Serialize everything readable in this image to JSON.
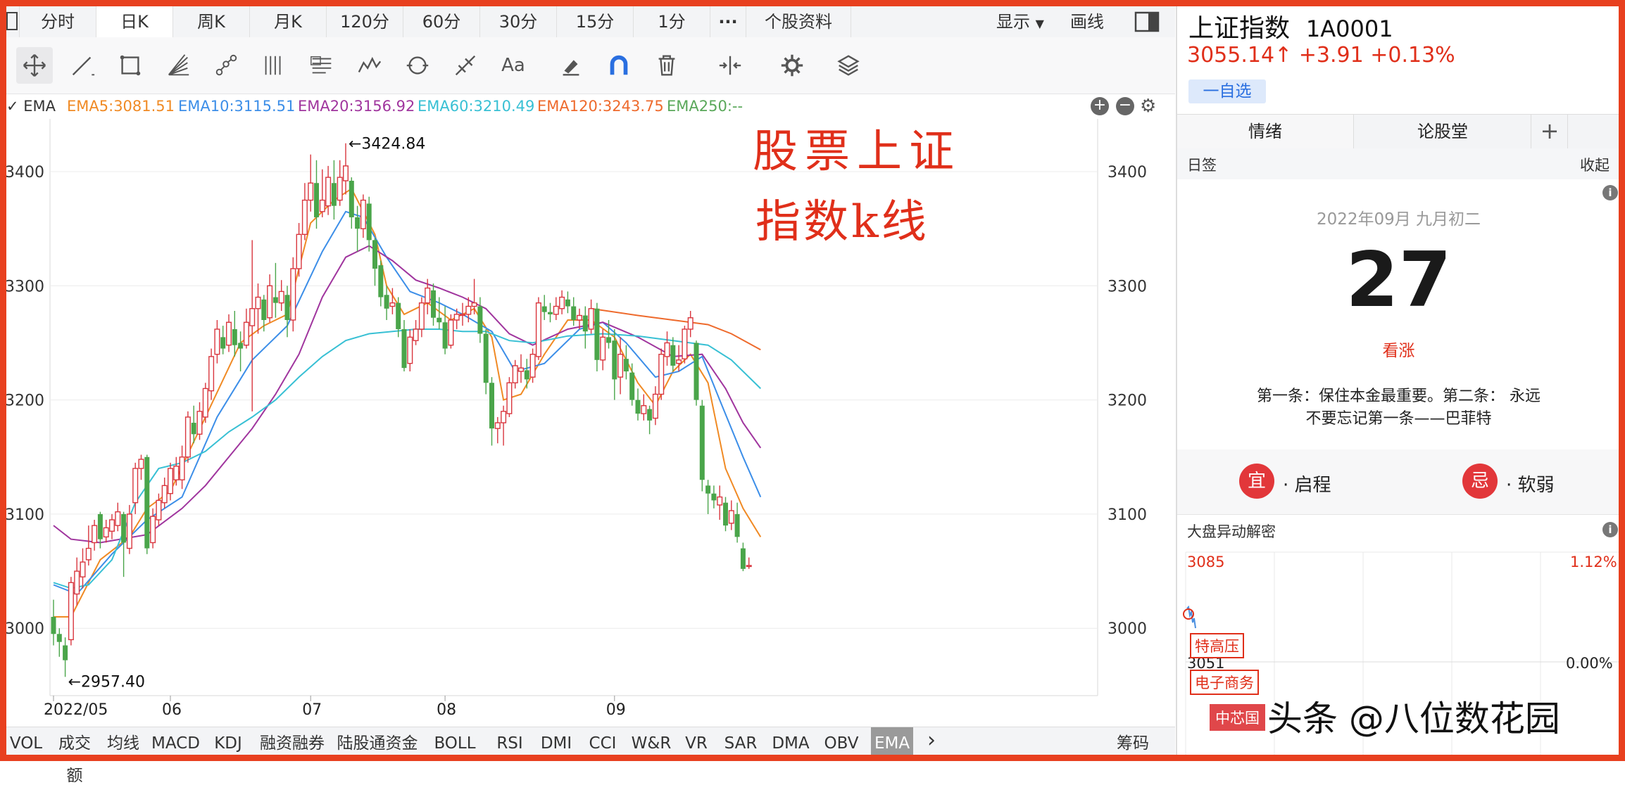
{
  "period_tabs": [
    "分时",
    "日K",
    "周K",
    "月K",
    "120分",
    "60分",
    "30分",
    "15分",
    "1分",
    "···",
    "个股资料",
    "显示",
    "画线"
  ],
  "active_period": 1,
  "ema_legend": {
    "label": "EMA",
    "items": [
      {
        "text": "EMA5:3081.51",
        "color": "#f08a24"
      },
      {
        "text": "EMA10:3115.51",
        "color": "#3c8ee8"
      },
      {
        "text": "EMA20:3156.92",
        "color": "#a0359e"
      },
      {
        "text": "EMA60:3210.49",
        "color": "#38c0d4"
      },
      {
        "text": "EMA120:3243.75",
        "color": "#ee6a2c"
      },
      {
        "text": "EMA250:--",
        "color": "#5aa85a"
      }
    ]
  },
  "annotation": {
    "line1": "股票上证",
    "line2": "指数k线",
    "color": "#e02f1a"
  },
  "indicator_tabs": [
    "VOL",
    "成交额",
    "均线",
    "MACD",
    "KDJ",
    "融资融券",
    "陆股通资金",
    "BOLL",
    "RSI",
    "DMI",
    "CCI",
    "W&R",
    "VR",
    "SAR",
    "DMA",
    "OBV",
    "EMA"
  ],
  "active_indicator": 16,
  "indicator_more": "›",
  "chips_label": "筹码",
  "chart_data": {
    "type": "candlestick",
    "x_ticks": [
      "2022/05",
      "06",
      "07",
      "08",
      "09"
    ],
    "y_ticks": [
      3000,
      3100,
      3200,
      3300,
      3400
    ],
    "ylim": [
      2940,
      3435
    ],
    "high_annotation": "←3424.84",
    "low_annotation": "←2957.40",
    "high_value": 3424.84,
    "low_value": 2957.4,
    "up_color": "#d9363e",
    "down_color": "#4aa54a",
    "candles": [
      [
        3010,
        2995,
        3025,
        2985
      ],
      [
        2995,
        2988,
        3000,
        2975
      ],
      [
        2985,
        2972,
        2992,
        2957.4
      ],
      [
        2990,
        3040,
        3045,
        2985
      ],
      [
        3030,
        3050,
        3062,
        3020
      ],
      [
        3045,
        3058,
        3070,
        3035
      ],
      [
        3060,
        3070,
        3090,
        3055
      ],
      [
        3075,
        3090,
        3095,
        3068
      ],
      [
        3100,
        3078,
        3102,
        3070
      ],
      [
        3080,
        3088,
        3095,
        3075
      ],
      [
        3085,
        3095,
        3100,
        3078
      ],
      [
        3090,
        3102,
        3110,
        3085
      ],
      [
        3100,
        3075,
        3102,
        3045
      ],
      [
        3070,
        3100,
        3108,
        3065
      ],
      [
        3110,
        3140,
        3145,
        3100
      ],
      [
        3140,
        3148,
        3152,
        3130
      ],
      [
        3150,
        3070,
        3152,
        3065
      ],
      [
        3075,
        3098,
        3105,
        3070
      ],
      [
        3095,
        3112,
        3118,
        3090
      ],
      [
        3110,
        3125,
        3132,
        3105
      ],
      [
        3118,
        3140,
        3145,
        3112
      ],
      [
        3130,
        3142,
        3150,
        3125
      ],
      [
        3130,
        3150,
        3160,
        3122
      ],
      [
        3150,
        3185,
        3190,
        3145
      ],
      [
        3180,
        3170,
        3195,
        3162
      ],
      [
        3170,
        3190,
        3198,
        3165
      ],
      [
        3185,
        3210,
        3215,
        3180
      ],
      [
        3208,
        3238,
        3245,
        3200
      ],
      [
        3240,
        3262,
        3270,
        3232
      ],
      [
        3255,
        3245,
        3265,
        3240
      ],
      [
        3248,
        3268,
        3275,
        3242
      ],
      [
        3262,
        3248,
        3278,
        3238
      ],
      [
        3250,
        3245,
        3260,
        3225
      ],
      [
        3248,
        3268,
        3280,
        3245
      ],
      [
        3265,
        3280,
        3340,
        3190
      ],
      [
        3280,
        3290,
        3302,
        3258
      ],
      [
        3288,
        3270,
        3292,
        3260
      ],
      [
        3272,
        3300,
        3310,
        3268
      ],
      [
        3290,
        3285,
        3320,
        3272
      ],
      [
        3285,
        3295,
        3305,
        3278
      ],
      [
        3292,
        3270,
        3300,
        3255
      ],
      [
        3270,
        3315,
        3325,
        3260
      ],
      [
        3315,
        3345,
        3355,
        3308
      ],
      [
        3345,
        3375,
        3390,
        3340
      ],
      [
        3375,
        3390,
        3415,
        3365
      ],
      [
        3390,
        3360,
        3410,
        3350
      ],
      [
        3365,
        3375,
        3402,
        3360
      ],
      [
        3370,
        3395,
        3405,
        3362
      ],
      [
        3390,
        3370,
        3410,
        3358
      ],
      [
        3375,
        3395,
        3410,
        3370
      ],
      [
        3392,
        3405,
        3424.84,
        3380
      ],
      [
        3392,
        3360,
        3395,
        3350
      ],
      [
        3360,
        3350,
        3370,
        3330
      ],
      [
        3350,
        3375,
        3380,
        3342
      ],
      [
        3372,
        3340,
        3378,
        3330
      ],
      [
        3340,
        3315,
        3342,
        3300
      ],
      [
        3318,
        3290,
        3322,
        3282
      ],
      [
        3292,
        3280,
        3300,
        3270
      ],
      [
        3282,
        3285,
        3298,
        3275
      ],
      [
        3285,
        3262,
        3290,
        3255
      ],
      [
        3262,
        3228,
        3270,
        3225
      ],
      [
        3232,
        3255,
        3262,
        3225
      ],
      [
        3252,
        3262,
        3270,
        3248
      ],
      [
        3262,
        3285,
        3290,
        3255
      ],
      [
        3285,
        3298,
        3306,
        3275
      ],
      [
        3296,
        3272,
        3302,
        3265
      ],
      [
        3272,
        3268,
        3290,
        3262
      ],
      [
        3268,
        3245,
        3282,
        3240
      ],
      [
        3248,
        3270,
        3275,
        3245
      ],
      [
        3270,
        3275,
        3280,
        3262
      ],
      [
        3275,
        3275,
        3285,
        3265
      ],
      [
        3275,
        3282,
        3290,
        3268
      ],
      [
        3282,
        3285,
        3306,
        3275
      ],
      [
        3282,
        3258,
        3290,
        3250
      ],
      [
        3258,
        3215,
        3262,
        3205
      ],
      [
        3215,
        3175,
        3220,
        3160
      ],
      [
        3175,
        3180,
        3185,
        3162
      ],
      [
        3180,
        3190,
        3195,
        3160
      ],
      [
        3188,
        3215,
        3220,
        3185
      ],
      [
        3215,
        3230,
        3235,
        3210
      ],
      [
        3225,
        3228,
        3240,
        3215
      ],
      [
        3226,
        3218,
        3236,
        3210
      ],
      [
        3220,
        3240,
        3245,
        3215
      ],
      [
        3238,
        3285,
        3290,
        3235
      ],
      [
        3282,
        3277,
        3292,
        3270
      ],
      [
        3277,
        3275,
        3285,
        3268
      ],
      [
        3275,
        3282,
        3290,
        3270
      ],
      [
        3280,
        3290,
        3296,
        3275
      ],
      [
        3288,
        3282,
        3295,
        3276
      ],
      [
        3282,
        3270,
        3290,
        3265
      ],
      [
        3270,
        3274,
        3280,
        3262
      ],
      [
        3274,
        3260,
        3282,
        3245
      ],
      [
        3262,
        3280,
        3288,
        3258
      ],
      [
        3280,
        3235,
        3285,
        3225
      ],
      [
        3235,
        3255,
        3262,
        3226
      ],
      [
        3255,
        3250,
        3270,
        3245
      ],
      [
        3252,
        3218,
        3262,
        3200
      ],
      [
        3220,
        3240,
        3255,
        3205
      ],
      [
        3236,
        3225,
        3248,
        3218
      ],
      [
        3224,
        3200,
        3232,
        3195
      ],
      [
        3200,
        3188,
        3210,
        3182
      ],
      [
        3188,
        3195,
        3205,
        3182
      ],
      [
        3192,
        3182,
        3195,
        3170
      ],
      [
        3184,
        3205,
        3212,
        3178
      ],
      [
        3205,
        3240,
        3245,
        3200
      ],
      [
        3238,
        3250,
        3260,
        3230
      ],
      [
        3248,
        3230,
        3255,
        3225
      ],
      [
        3232,
        3235,
        3248,
        3225
      ],
      [
        3236,
        3262,
        3265,
        3232
      ],
      [
        3262,
        3272,
        3278,
        3255
      ],
      [
        3250,
        3200,
        3252,
        3195
      ],
      [
        3195,
        3130,
        3200,
        3120
      ],
      [
        3125,
        3118,
        3130,
        3100
      ],
      [
        3118,
        3112,
        3125,
        3105
      ],
      [
        3108,
        3115,
        3125,
        3095
      ],
      [
        3110,
        3090,
        3115,
        3085
      ],
      [
        3092,
        3103,
        3112,
        3086
      ],
      [
        3100,
        3080,
        3110,
        3075
      ],
      [
        3070,
        3052,
        3075,
        3050
      ],
      [
        3055,
        3055,
        3062,
        3052
      ]
    ],
    "ema": [
      {
        "name": "EMA5",
        "color": "#f08a24",
        "points": [
          [
            0,
            3010
          ],
          [
            3,
            3010
          ],
          [
            8,
            3060
          ],
          [
            13,
            3080
          ],
          [
            16,
            3105
          ],
          [
            20,
            3120
          ],
          [
            26,
            3185
          ],
          [
            32,
            3250
          ],
          [
            36,
            3265
          ],
          [
            40,
            3275
          ],
          [
            44,
            3355
          ],
          [
            48,
            3375
          ],
          [
            51,
            3385
          ],
          [
            55,
            3345
          ],
          [
            57,
            3300
          ],
          [
            60,
            3275
          ],
          [
            64,
            3285
          ],
          [
            68,
            3270
          ],
          [
            72,
            3280
          ],
          [
            75,
            3255
          ],
          [
            77,
            3200
          ],
          [
            80,
            3205
          ],
          [
            84,
            3240
          ],
          [
            88,
            3270
          ],
          [
            92,
            3270
          ],
          [
            96,
            3255
          ],
          [
            100,
            3215
          ],
          [
            103,
            3195
          ],
          [
            106,
            3225
          ],
          [
            109,
            3240
          ],
          [
            112,
            3215
          ],
          [
            115,
            3140
          ],
          [
            118,
            3105
          ],
          [
            121,
            3080
          ]
        ]
      },
      {
        "name": "EMA10",
        "color": "#3c8ee8",
        "points": [
          [
            0,
            3038
          ],
          [
            4,
            3030
          ],
          [
            10,
            3065
          ],
          [
            16,
            3095
          ],
          [
            22,
            3115
          ],
          [
            28,
            3185
          ],
          [
            34,
            3235
          ],
          [
            40,
            3265
          ],
          [
            46,
            3330
          ],
          [
            50,
            3365
          ],
          [
            53,
            3360
          ],
          [
            57,
            3325
          ],
          [
            61,
            3295
          ],
          [
            66,
            3285
          ],
          [
            70,
            3275
          ],
          [
            75,
            3260
          ],
          [
            79,
            3225
          ],
          [
            84,
            3232
          ],
          [
            90,
            3262
          ],
          [
            94,
            3268
          ],
          [
            98,
            3250
          ],
          [
            103,
            3220
          ],
          [
            107,
            3225
          ],
          [
            111,
            3238
          ],
          [
            114,
            3200
          ],
          [
            118,
            3150
          ],
          [
            121,
            3115
          ]
        ]
      },
      {
        "name": "EMA20",
        "color": "#a0359e",
        "points": [
          [
            0,
            3090
          ],
          [
            3,
            3078
          ],
          [
            8,
            3075
          ],
          [
            16,
            3082
          ],
          [
            22,
            3105
          ],
          [
            26,
            3125
          ],
          [
            30,
            3150
          ],
          [
            34,
            3175
          ],
          [
            38,
            3205
          ],
          [
            42,
            3240
          ],
          [
            46,
            3290
          ],
          [
            50,
            3325
          ],
          [
            54,
            3335
          ],
          [
            58,
            3322
          ],
          [
            62,
            3305
          ],
          [
            66,
            3298
          ],
          [
            70,
            3290
          ],
          [
            74,
            3280
          ],
          [
            78,
            3258
          ],
          [
            82,
            3248
          ],
          [
            88,
            3262
          ],
          [
            94,
            3268
          ],
          [
            100,
            3255
          ],
          [
            106,
            3238
          ],
          [
            111,
            3240
          ],
          [
            115,
            3210
          ],
          [
            118,
            3180
          ],
          [
            121,
            3158
          ]
        ]
      },
      {
        "name": "EMA60",
        "color": "#38c0d4",
        "points": [
          [
            0,
            3040
          ],
          [
            3,
            3035
          ],
          [
            6,
            3038
          ],
          [
            10,
            3060
          ],
          [
            14,
            3110
          ],
          [
            18,
            3140
          ],
          [
            22,
            3145
          ],
          [
            26,
            3155
          ],
          [
            30,
            3172
          ],
          [
            34,
            3185
          ],
          [
            38,
            3200
          ],
          [
            42,
            3220
          ],
          [
            46,
            3238
          ],
          [
            50,
            3252
          ],
          [
            54,
            3258
          ],
          [
            58,
            3260
          ],
          [
            62,
            3262
          ],
          [
            66,
            3262
          ],
          [
            70,
            3260
          ],
          [
            74,
            3260
          ],
          [
            78,
            3252
          ],
          [
            82,
            3250
          ],
          [
            88,
            3256
          ],
          [
            94,
            3258
          ],
          [
            100,
            3256
          ],
          [
            106,
            3252
          ],
          [
            112,
            3248
          ],
          [
            116,
            3235
          ],
          [
            121,
            3210
          ]
        ]
      },
      {
        "name": "EMA120",
        "color": "#ee6a2c",
        "points": [
          [
            92,
            3280
          ],
          [
            100,
            3274
          ],
          [
            106,
            3270
          ],
          [
            112,
            3266
          ],
          [
            116,
            3258
          ],
          [
            121,
            3244
          ]
        ]
      }
    ]
  },
  "quote": {
    "name": "上证指数",
    "code": "1A0001",
    "price": "3055.14↑",
    "change": "+3.91",
    "pct": "+0.13%",
    "watch": "一自选"
  },
  "side_tabs": [
    "情绪",
    "论股堂",
    "+"
  ],
  "daily": {
    "header": "日签",
    "collapse": "收起",
    "info_icon": "i",
    "date": "2022年09月 九月初二",
    "day": "27",
    "mood": "看涨",
    "quote_line1": "第一条：保住本金最重要。第二条： 永远",
    "quote_line2": "不要忘记第一条——巴菲特",
    "good_badge": "宜",
    "good_text": "· 启程",
    "bad_badge": "忌",
    "bad_text": "· 软弱"
  },
  "mini": {
    "header": "大盘异动解密",
    "top_left": "3085",
    "top_right": "1.12%",
    "mid_left": "3051",
    "mid_right": "0.00%",
    "tags": [
      "特高压",
      "电子商务",
      "中芯国"
    ]
  },
  "watermark": "头条 @八位数花园"
}
